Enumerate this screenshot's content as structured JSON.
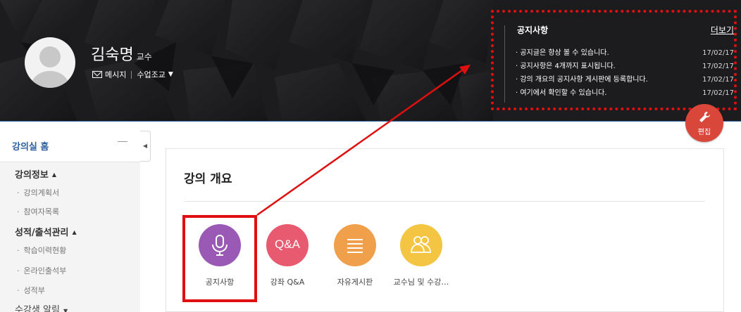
{
  "professor": {
    "name": "김숙명",
    "role": "교수",
    "message_label": "메시지",
    "course_menu_label": "수업조교"
  },
  "notice": {
    "title": "공지사항",
    "more_label": "더보기",
    "items": [
      {
        "text": "· 공지글은 항상 볼 수 있습니다.",
        "date": "17/02/17"
      },
      {
        "text": "· 공지사항은 4개까지 표시됩니다.",
        "date": "17/02/17"
      },
      {
        "text": "· 강의 개요의 공지사항 게시판에 등록합니다.",
        "date": "17/02/17"
      },
      {
        "text": "· 여기에서 확인할 수 있습니다.",
        "date": "17/02/17"
      }
    ]
  },
  "edit_button": {
    "label": "편집"
  },
  "sidebar": {
    "home_label": "강의실 홈",
    "groups": [
      {
        "label": "강의정보",
        "items": [
          "강의계획서",
          "참여자목록"
        ]
      },
      {
        "label": "성적/출석관리",
        "items": [
          "학습이력현황",
          "온라인출석부",
          "성적부"
        ]
      }
    ],
    "alert_label": "수강생 알림"
  },
  "main": {
    "title": "강의 개요",
    "menu": [
      {
        "label": "공지사항",
        "icon": "microphone-icon",
        "color": "#9b59b6"
      },
      {
        "label": "강좌 Q&A",
        "icon": "qa-icon",
        "color": "#e75a70",
        "text": "Q&A"
      },
      {
        "label": "자유게시판",
        "icon": "list-icon",
        "color": "#f0a04b"
      },
      {
        "label": "교수님 및 수강…",
        "icon": "users-icon",
        "color": "#f4c542"
      }
    ]
  },
  "colors": {
    "annotation": "#e01010",
    "accent": "#2b5f9e"
  }
}
